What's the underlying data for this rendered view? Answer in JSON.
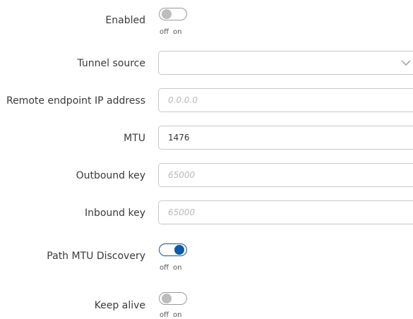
{
  "form": {
    "enabled": {
      "label": "Enabled",
      "state": "off",
      "off_label": "off",
      "on_label": "on"
    },
    "tunnel_source": {
      "label": "Tunnel source",
      "value": ""
    },
    "remote_endpoint": {
      "label": "Remote endpoint IP address",
      "placeholder": "0.0.0.0"
    },
    "mtu": {
      "label": "MTU",
      "value": "1476"
    },
    "outbound_key": {
      "label": "Outbound key",
      "placeholder": "65000"
    },
    "inbound_key": {
      "label": "Inbound key",
      "placeholder": "65000"
    },
    "path_mtu_discovery": {
      "label": "Path MTU Discovery",
      "state": "on",
      "off_label": "off",
      "on_label": "on"
    },
    "keep_alive": {
      "label": "Keep alive",
      "state": "off",
      "off_label": "off",
      "on_label": "on"
    }
  },
  "colors": {
    "toggle_on": "#0b5aa6",
    "toggle_off_knob": "#bdbdbd",
    "field_border": "#c8c8c8",
    "placeholder": "#b9b9b9"
  },
  "icons": {
    "tunnel_source_dropdown": "chevron-down-icon"
  }
}
